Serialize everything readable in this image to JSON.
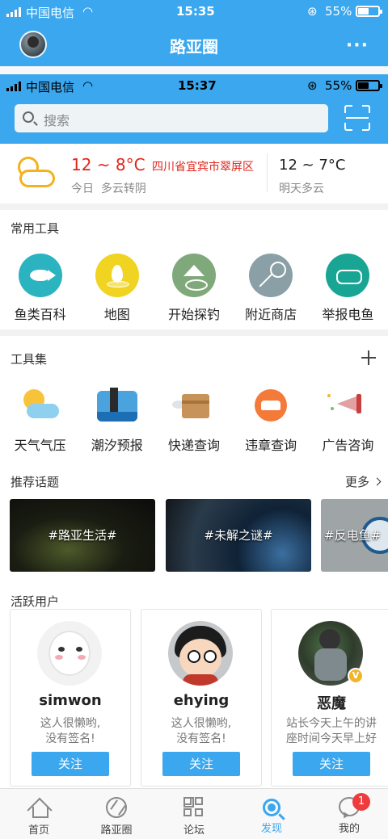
{
  "outer_status": {
    "carrier": "中国电信",
    "time": "15:35",
    "battery": "55%",
    "battery_level": 0.55
  },
  "outer_nav": {
    "title": "路亚圈",
    "more": "···"
  },
  "inner_status": {
    "carrier": "中国电信",
    "time": "15:37",
    "battery": "55%",
    "battery_level": 0.55
  },
  "search": {
    "placeholder": "搜索"
  },
  "weather": {
    "today_temp": "12 ~ 8°C",
    "location": "四川省宜宾市翠屏区",
    "today_label": "今日",
    "today_desc": "多云转阴",
    "tomorrow_temp": "12 ~ 7°C",
    "tomorrow_desc": "明天多云"
  },
  "common_tools": {
    "title": "常用工具",
    "items": [
      {
        "label": "鱼类百科",
        "icon": "fish-icon",
        "color": "#2bb3c0"
      },
      {
        "label": "地图",
        "icon": "map-pin-icon",
        "color": "#f1d321"
      },
      {
        "label": "开始探钓",
        "icon": "fishing-spot-icon",
        "color": "#7fa97a"
      },
      {
        "label": "附近商店",
        "icon": "landing-net-icon",
        "color": "#8aa0a6"
      },
      {
        "label": "举报电鱼",
        "icon": "handshake-icon",
        "color": "#19a593"
      }
    ]
  },
  "tool_set": {
    "title": "工具集",
    "items": [
      {
        "label": "天气气压",
        "icon": "weather-icon"
      },
      {
        "label": "潮汐预报",
        "icon": "lighthouse-icon"
      },
      {
        "label": "快递查询",
        "icon": "parcel-icon"
      },
      {
        "label": "违章查询",
        "icon": "car-icon"
      },
      {
        "label": "广告咨询",
        "icon": "megaphone-icon"
      }
    ]
  },
  "topics": {
    "title": "推荐话题",
    "more": "更多",
    "items": [
      {
        "label": "#路亚生活#"
      },
      {
        "label": "#未解之谜#"
      },
      {
        "label": "#反电鱼#"
      }
    ]
  },
  "active_users": {
    "title": "活跃用户",
    "users": [
      {
        "name": "simwon",
        "sig_line1": "这人很懒哟,",
        "sig_line2": "没有签名!",
        "follow": "关注"
      },
      {
        "name": "ehying",
        "sig_line1": "这人很懒哟,",
        "sig_line2": "没有签名!",
        "follow": "关注"
      },
      {
        "name": "恶魔",
        "sig_line1": "站长今天上午的讲",
        "sig_line2": "座时间今天早上好",
        "follow": "关注",
        "verified": "V"
      }
    ]
  },
  "tabbar": {
    "items": [
      {
        "label": "首页"
      },
      {
        "label": "路亚圈"
      },
      {
        "label": "论坛"
      },
      {
        "label": "发现",
        "active": true
      },
      {
        "label": "我的",
        "badge": "1"
      }
    ]
  },
  "colors": {
    "brand": "#3aa7ee",
    "alert": "#e1251b",
    "badge": "#ef3b3b"
  }
}
